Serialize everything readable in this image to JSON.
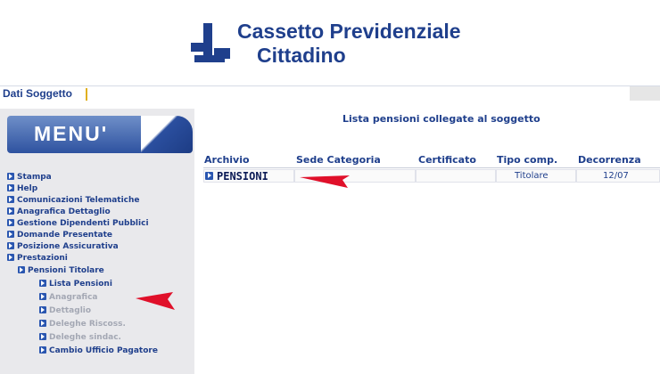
{
  "header": {
    "logo_line1": "Cassetto Previdenziale",
    "logo_line2": "Cittadino",
    "brand_color": "#1f3f8c"
  },
  "topbar": {
    "label": "Dati Soggetto"
  },
  "menu": {
    "title": "MENU'",
    "items": [
      "Stampa",
      "Help",
      "Comunicazioni Telematiche",
      "Anagrafica Dettaglio",
      "Gestione Dipendenti Pubblici",
      "Domande Presentate",
      "Posizione Assicurativa",
      "Prestazioni"
    ],
    "sub": "Pensioni Titolare",
    "subitems": [
      "Lista Pensioni",
      "Anagrafica",
      "Dettaglio",
      "Deleghe Riscoss.",
      "Deleghe sindac.",
      "Cambio Ufficio Pagatore"
    ]
  },
  "content": {
    "title": "Lista pensioni collegate al soggetto",
    "columns": [
      "Archivio",
      "Sede Categoria",
      "Certificato",
      "Tipo comp.",
      "Decorrenza"
    ],
    "rows": [
      {
        "archivio": "PENSIONI",
        "sede_categoria": "",
        "certificato": "",
        "tipo_comp": "Titolare",
        "decorrenza": "12/07"
      }
    ]
  },
  "annotation_color": "#e0102a"
}
